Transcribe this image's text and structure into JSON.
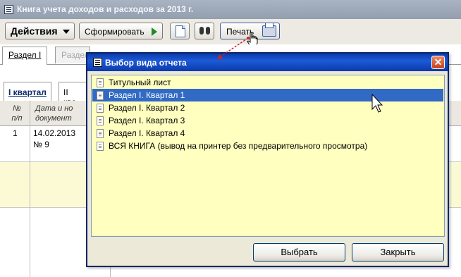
{
  "window": {
    "title": "Книга учета доходов и расходов за 2013 г."
  },
  "toolbar": {
    "actions_label": "Действия",
    "form_label": "Сформировать",
    "print_label": "Печать",
    "icons": [
      "document-icon",
      "binoculars-icon",
      "printer-icon"
    ]
  },
  "tabs": [
    "Раздел I",
    "Раздел"
  ],
  "subtabs": [
    "I квартал",
    "II ква"
  ],
  "grid": {
    "headers": {
      "num": "№\nп/п",
      "date": "Дата и но\nдокумент"
    },
    "rows": [
      {
        "num": "1",
        "date": "14.02.2013",
        "doc": "№ 9"
      }
    ]
  },
  "dialog": {
    "title": "Выбор вида отчета",
    "items": [
      "Титульный лист",
      "Раздел I. Квартал 1",
      "Раздел I. Квартал 2",
      "Раздел I. Квартал 3",
      "Раздел I. Квартал 4",
      "ВСЯ КНИГА (вывод на принтер без предварительного просмотра)"
    ],
    "selected_index": 1,
    "select_button": "Выбрать",
    "close_button": "Закрыть",
    "close_glyph": "✕"
  },
  "colors": {
    "selection": "#316ac5",
    "list_bg": "#ffffbf",
    "title_bar": "#0b3aa9"
  }
}
